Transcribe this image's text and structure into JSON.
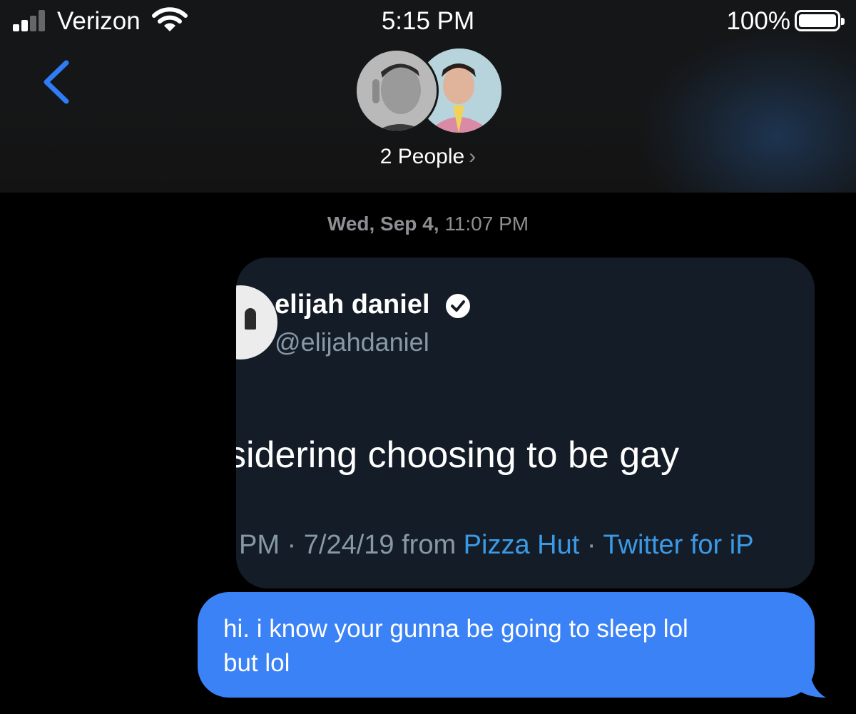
{
  "status_bar": {
    "carrier": "Verizon",
    "time": "5:15 PM",
    "battery_percent": "100%",
    "battery_level": 1.0,
    "signal_bars_active": 2,
    "signal_bars_total": 4
  },
  "nav": {
    "back_icon": "chevron-left-icon",
    "group_label": "2 People",
    "group_chevron": "›"
  },
  "conversation": {
    "timestamp_day": "Wed, Sep 4,",
    "timestamp_time": "11:07 PM",
    "messages": [
      {
        "type": "image",
        "sent": true,
        "tweet": {
          "name": "elijah daniel",
          "handle": "@elijahdaniel",
          "text": "sidering choosing to be gay",
          "meta_prefix": "PM · 7/24/19 from ",
          "meta_link_1": "Pizza Hut",
          "meta_sep": " · ",
          "meta_link_2": "Twitter for iP"
        }
      },
      {
        "type": "text",
        "sent": true,
        "line_1": "hi. i know your gunna be going to sleep lol",
        "line_2": "but lol"
      }
    ]
  },
  "colors": {
    "sent_bubble": "#3b82f6",
    "ios_blue": "#2f7cf6",
    "twitter_link": "#3b9ae6",
    "background": "#000000"
  }
}
